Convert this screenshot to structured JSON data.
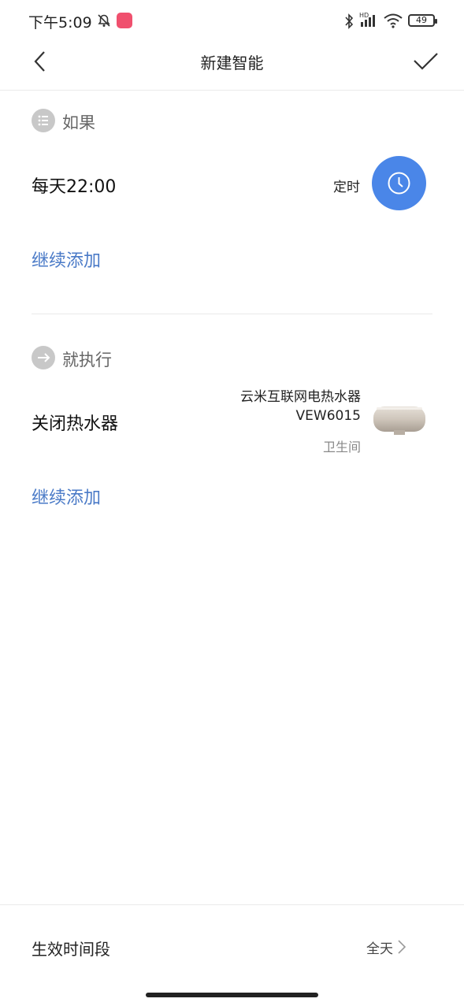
{
  "status_bar": {
    "time": "下午5:09",
    "battery": "49"
  },
  "nav": {
    "title": "新建智能"
  },
  "if_section": {
    "label": "如果",
    "condition": "每天22:00",
    "condition_type": "定时",
    "add_label": "继续添加"
  },
  "then_section": {
    "label": "就执行",
    "action": "关闭热水器",
    "device_name_line1": "云米互联网电热水器",
    "device_name_line2": "VEW6015",
    "device_room": "卫生间",
    "add_label": "继续添加"
  },
  "effective_period": {
    "label": "生效时间段",
    "value": "全天"
  },
  "colors": {
    "accent_blue": "#4a86e8",
    "link_blue": "#4a7ac7",
    "section_icon_gray": "#c8c8c8"
  }
}
